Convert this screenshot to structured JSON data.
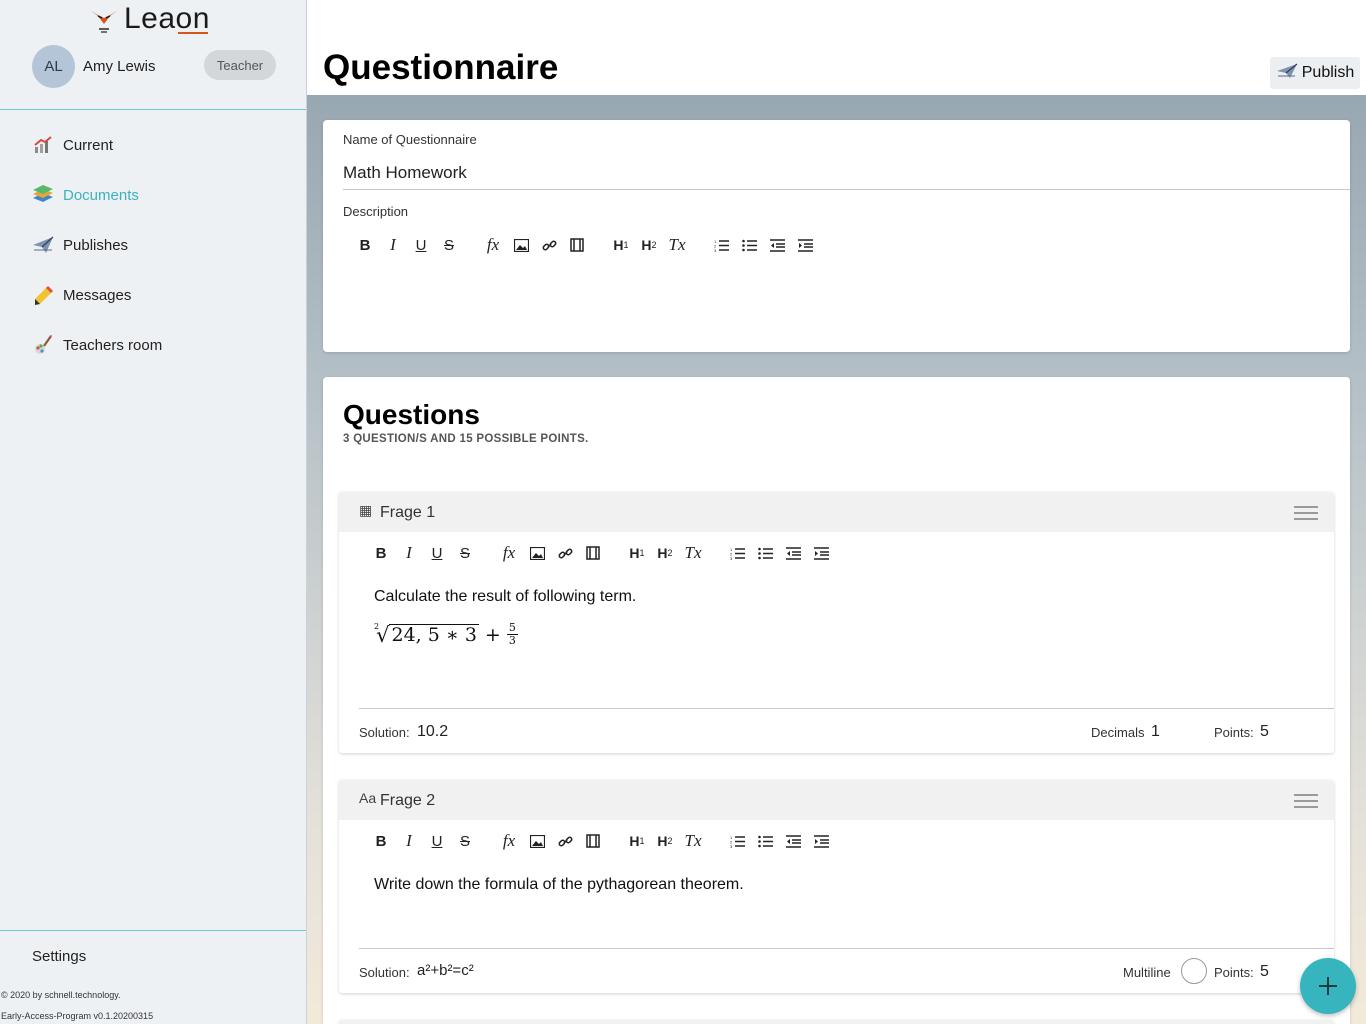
{
  "app": {
    "name": "Leaon"
  },
  "user": {
    "initials": "AL",
    "name": "Amy Lewis",
    "role": "Teacher"
  },
  "sidebar": {
    "items": [
      {
        "label": "Current",
        "icon": "chart-icon",
        "active": false
      },
      {
        "label": "Documents",
        "icon": "books-icon",
        "active": true
      },
      {
        "label": "Publishes",
        "icon": "paper-plane-icon",
        "active": false
      },
      {
        "label": "Messages",
        "icon": "pencil-icon",
        "active": false
      },
      {
        "label": "Teachers room",
        "icon": "palette-icon",
        "active": false
      }
    ],
    "settings_label": "Settings",
    "copyright": "© 2020 by schnell.technology.",
    "version": "Early-Access-Program v0.1.20200315"
  },
  "header": {
    "title": "Questionnaire",
    "publish_label": "Publish"
  },
  "form": {
    "name_label": "Name of Questionnaire",
    "name_value": "Math Homework",
    "description_label": "Description"
  },
  "toolbar": {
    "bold": "B",
    "italic": "I",
    "underline": "U",
    "strike": "S",
    "formula": "fx",
    "h1": "H",
    "h2": "H",
    "clear": "Tx"
  },
  "questions": {
    "title": "Questions",
    "summary": "3 QUESTION/S AND 15 POSSIBLE POINTS.",
    "items": [
      {
        "type_icon": "calculator-icon",
        "type_glyph": "▦",
        "title": "Frage 1",
        "text": "Calculate the result of following term.",
        "formula": {
          "root_index": "2",
          "radicand": "24, 5 ∗ 3",
          "plus": "+",
          "numerator": "5",
          "denominator": "3"
        },
        "solution_label": "Solution:",
        "solution_value": "10.2",
        "decimals_label": "Decimals",
        "decimals_value": "1",
        "points_label": "Points:",
        "points_value": "5"
      },
      {
        "type_icon": "text-icon",
        "type_glyph": "Aa",
        "title": "Frage 2",
        "text": "Write down the formula of the pythagorean theorem.",
        "solution_label": "Solution:",
        "solution_value": "a²+b²=c²",
        "multiline_label": "Multiline",
        "multiline_checked": false,
        "points_label": "Points:",
        "points_value": "5"
      }
    ]
  },
  "colors": {
    "accent": "#36b5bf",
    "active_nav": "#3bb3bc",
    "divider": "#6fc9cf",
    "brand_orange": "#d9531e"
  }
}
